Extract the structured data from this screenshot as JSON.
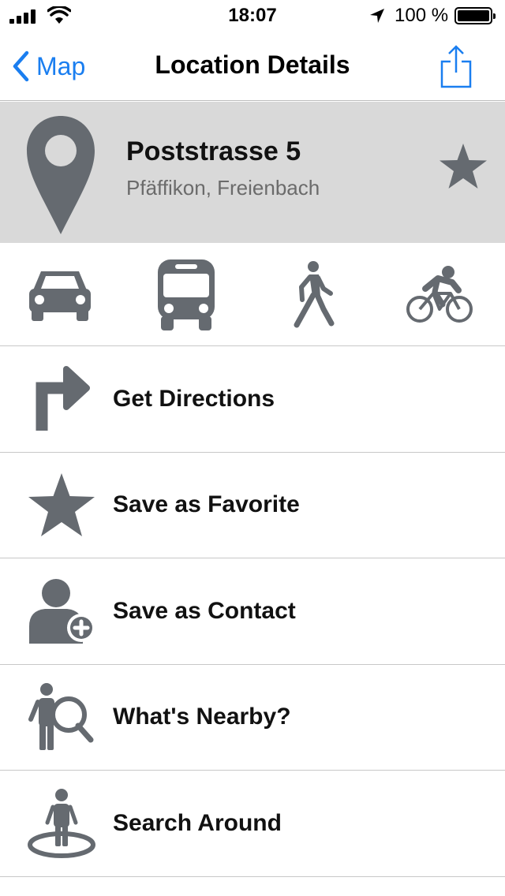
{
  "status_bar": {
    "time": "18:07",
    "battery": "100 %"
  },
  "nav": {
    "back_label": "Map",
    "title": "Location Details"
  },
  "location": {
    "name": "Poststrasse 5",
    "subtitle": "Pfäffikon, Freienbach"
  },
  "transport_modes": [
    "car-icon",
    "bus-icon",
    "walk-icon",
    "bicycle-icon"
  ],
  "menu": [
    {
      "label": "Get Directions",
      "icon": "turn-right-arrow-icon"
    },
    {
      "label": "Save as Favorite",
      "icon": "star-icon"
    },
    {
      "label": "Save as Contact",
      "icon": "add-contact-icon"
    },
    {
      "label": "What's Nearby?",
      "icon": "person-search-icon"
    },
    {
      "label": "Search Around",
      "icon": "person-radius-icon"
    }
  ],
  "colors": {
    "accent": "#1a7ef0",
    "icon_gray": "#656a70",
    "header_bg": "#d9d9d9"
  }
}
